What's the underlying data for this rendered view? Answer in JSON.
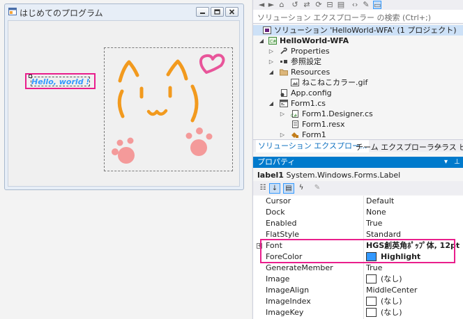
{
  "form": {
    "title": "はじめてのプログラム",
    "label_text": "Hello, world !"
  },
  "solution_explorer": {
    "search_placeholder": "ソリューション エクスプローラー の検索 (Ctrl+;)",
    "tree": [
      {
        "label": "ソリューション 'HelloWorld-WFA' (1 プロジェクト)",
        "icon": "solution-icon",
        "selected": true
      },
      {
        "label": "HelloWorld-WFA",
        "icon": "csharp-project-icon",
        "bold": true
      },
      {
        "label": "Properties",
        "icon": "wrench-icon"
      },
      {
        "label": "参照設定",
        "icon": "references-icon"
      },
      {
        "label": "Resources",
        "icon": "folder-icon"
      },
      {
        "label": "ねこねこカラー.gif",
        "icon": "image-file-icon"
      },
      {
        "label": "App.config",
        "icon": "config-file-icon"
      },
      {
        "label": "Form1.cs",
        "icon": "form-icon"
      },
      {
        "label": "Form1.Designer.cs",
        "icon": "csharp-file-icon"
      },
      {
        "label": "Form1.resx",
        "icon": "resx-file-icon"
      },
      {
        "label": "Form1",
        "icon": "class-icon"
      }
    ],
    "tabs": [
      "ソリューション エクスプロー...",
      "チーム エクスプローラー",
      "クラス ビュ"
    ]
  },
  "properties": {
    "header": "プロパティ",
    "object_name": "label1",
    "object_type": "System.Windows.Forms.Label",
    "rows": [
      {
        "name": "Cursor",
        "value": "Default"
      },
      {
        "name": "Dock",
        "value": "None"
      },
      {
        "name": "Enabled",
        "value": "True"
      },
      {
        "name": "FlatStyle",
        "value": "Standard"
      },
      {
        "name": "Font",
        "value": "HGS創英角ﾎﾟｯﾌﾟ体, 12pt"
      },
      {
        "name": "ForeColor",
        "value": "Highlight"
      },
      {
        "name": "GenerateMember",
        "value": "True"
      },
      {
        "name": "Image",
        "value": "(なし)"
      },
      {
        "name": "ImageAlign",
        "value": "MiddleCenter"
      },
      {
        "name": "ImageIndex",
        "value": "(なし)"
      },
      {
        "name": "ImageKey",
        "value": "(なし)"
      }
    ]
  },
  "colors": {
    "accent": "#007acc",
    "highlight_fore": "#3399ff",
    "annotation": "#e91e8c",
    "cat_orange": "#f29a1e",
    "paw_pink": "#f49a9a",
    "heart_pink": "#e8559a"
  }
}
